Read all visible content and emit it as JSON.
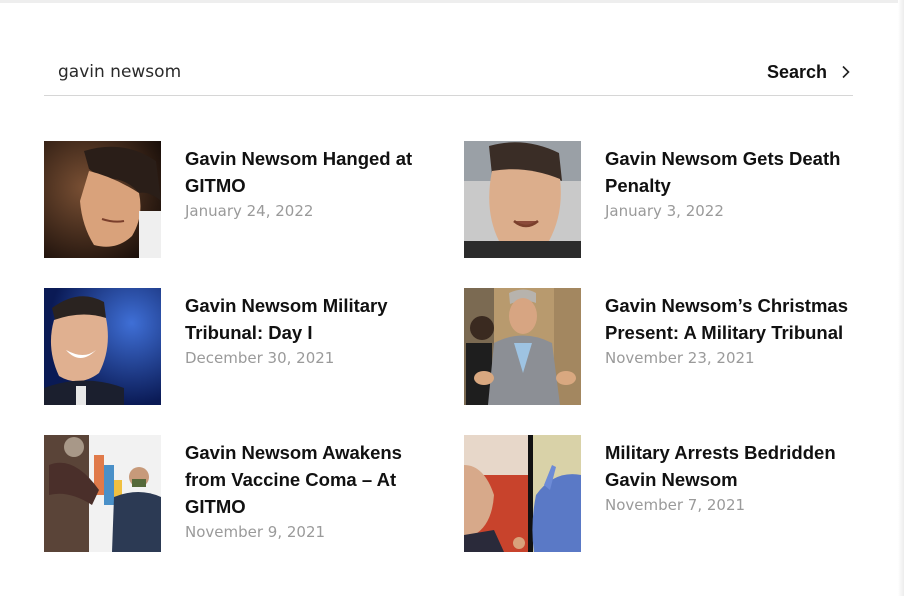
{
  "search": {
    "value": "gavin newsom",
    "button_label": "Search",
    "button_icon": "chevron-right-icon"
  },
  "results": [
    {
      "title": "Gavin Newsom Hanged at GITMO",
      "date": "January 24, 2022"
    },
    {
      "title": "Gavin Newsom Gets Death Penalty",
      "date": "January 3, 2022"
    },
    {
      "title": "Gavin Newsom Military Tribunal: Day I",
      "date": "December 30, 2021"
    },
    {
      "title": "Gavin Newsom’s Christmas Present: A Military Tribunal",
      "date": "November 23, 2021"
    },
    {
      "title": "Gavin Newsom Awakens from Vaccine Coma – At GITMO",
      "date": "November 9, 2021"
    },
    {
      "title": "Military Arrests Bedridden Gavin Newsom",
      "date": "November 7, 2021"
    }
  ]
}
